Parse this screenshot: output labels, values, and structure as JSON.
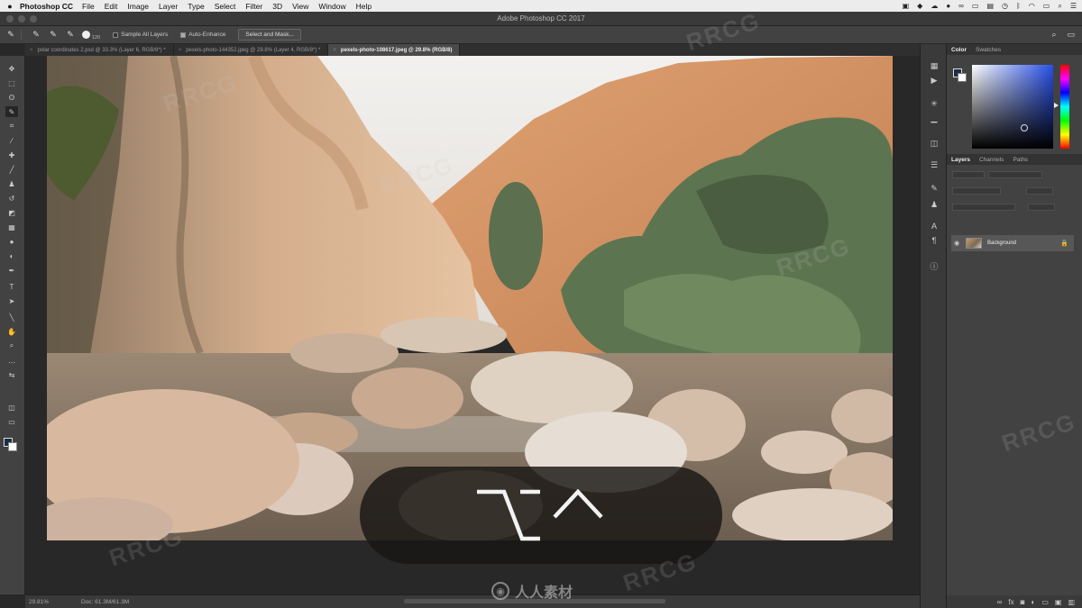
{
  "menubar": {
    "apple": "",
    "app_name": "Photoshop CC",
    "items": [
      "File",
      "Edit",
      "Image",
      "Layer",
      "Type",
      "Select",
      "Filter",
      "3D",
      "View",
      "Window",
      "Help"
    ]
  },
  "window": {
    "title": "Adobe Photoshop CC 2017"
  },
  "options_bar": {
    "brush_size": "120",
    "sample_all_layers": "Sample All Layers",
    "auto_enhance": "Auto-Enhance",
    "select_and_mask": "Select and Mask..."
  },
  "tabs": [
    {
      "label": "polar coordinates 2.psd @ 33.3% (Layer 6, RGB/8*) *",
      "active": false
    },
    {
      "label": "pexels-photo-144352.jpeg @ 29.8% (Layer 4, RGB/8*) *",
      "active": false
    },
    {
      "label": "pexels-photo-108617.jpeg @ 29.8% (RGB/8)",
      "active": true
    }
  ],
  "keystroke_overlay": {
    "keys": [
      "option-key",
      "control-key"
    ]
  },
  "status_bar": {
    "zoom": "29.81%",
    "doc": "Doc: 61.3M/61.3M",
    "watermark": "人人素材"
  },
  "panels": {
    "color_tabs": [
      "Color",
      "Swatches"
    ],
    "layers_tabs": [
      "Layers",
      "Channels",
      "Paths"
    ],
    "layer_name": "Background"
  },
  "colors": {
    "foreground": "#1b2e44",
    "background": "#ffffff",
    "ui_dark": "#282828",
    "ui_panel": "#424242"
  },
  "watermark_text": "RRCG"
}
